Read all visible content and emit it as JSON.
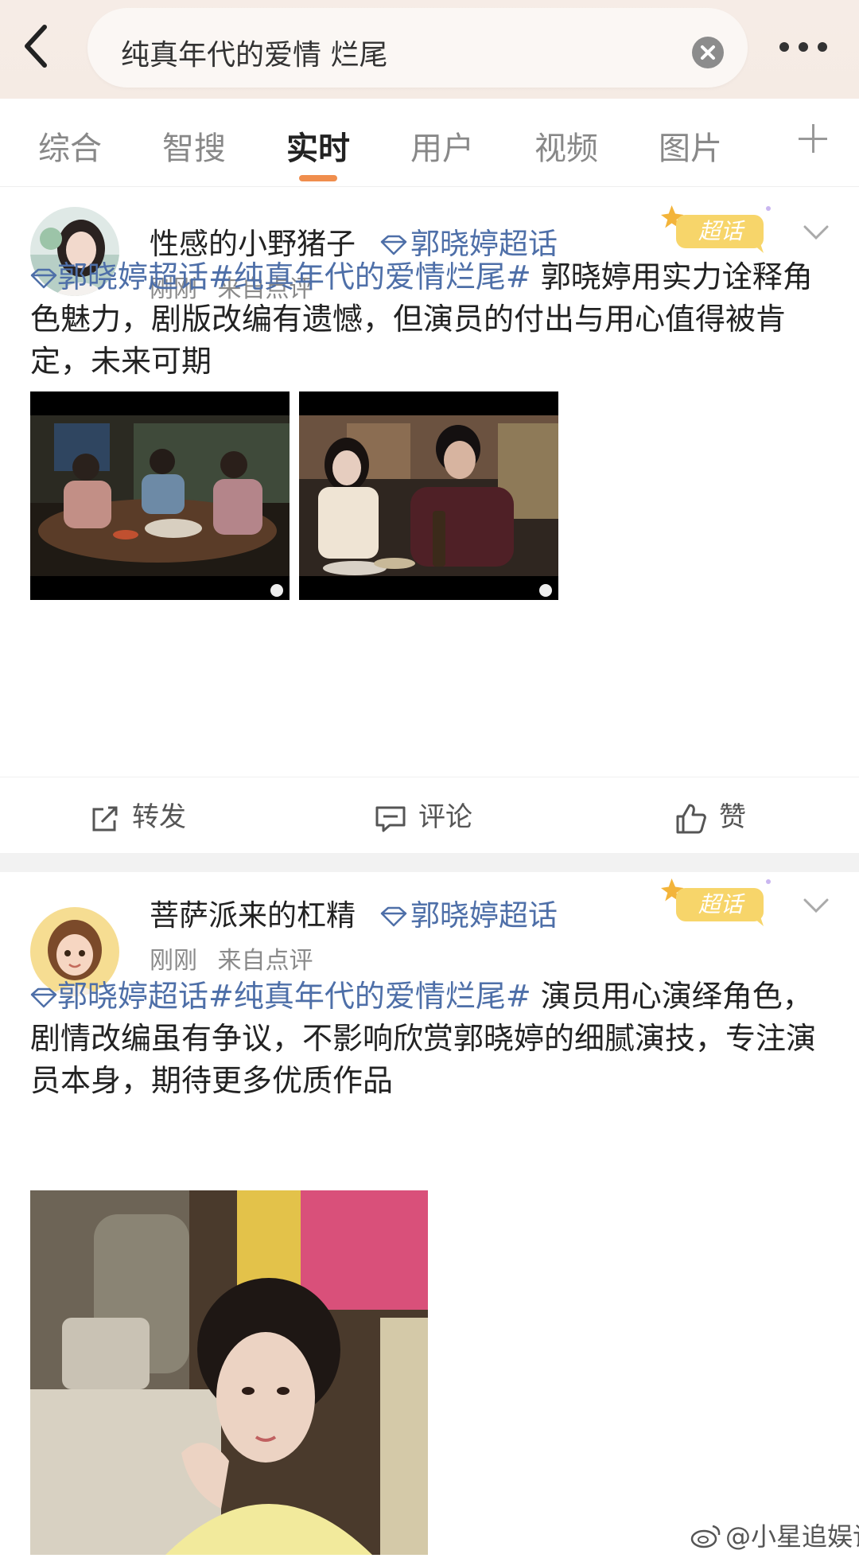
{
  "search": {
    "query": "纯真年代的爱情 烂尾"
  },
  "tabs": [
    {
      "label": "综合"
    },
    {
      "label": "智搜"
    },
    {
      "label": "实时"
    },
    {
      "label": "用户"
    },
    {
      "label": "视频"
    },
    {
      "label": "图片"
    }
  ],
  "active_tab": "实时",
  "posts": [
    {
      "username": "性感的小野猪子",
      "topic": "郭晓婷超话",
      "meta": {
        "time": "刚刚",
        "source": "来自点评"
      },
      "badge": "超话",
      "hashtag_topic": "郭晓婷超话",
      "hashtag": "#纯真年代的爱情烂尾#",
      "text": " 郭晓婷用实力诠释角色魅力，剧版改编有遗憾，但演员的付出与用心值得被肯定，未来可期",
      "actions": {
        "repost": "转发",
        "comment": "评论",
        "like": "赞"
      }
    },
    {
      "username": "菩萨派来的杠精",
      "topic": "郭晓婷超话",
      "meta": {
        "time": "刚刚",
        "source": "来自点评"
      },
      "badge": "超话",
      "hashtag_topic": "郭晓婷超话",
      "hashtag": "#纯真年代的爱情烂尾#",
      "text": " 演员用心演绎角色，剧情改编虽有争议，不影响欣赏郭晓婷的细腻演技，专注演员本身，期待更多优质作品"
    }
  ],
  "watermark": "@小星追娱记",
  "colors": {
    "accent": "#f08e4d",
    "link": "#4e6fa8",
    "badge": "#f3c94a"
  }
}
